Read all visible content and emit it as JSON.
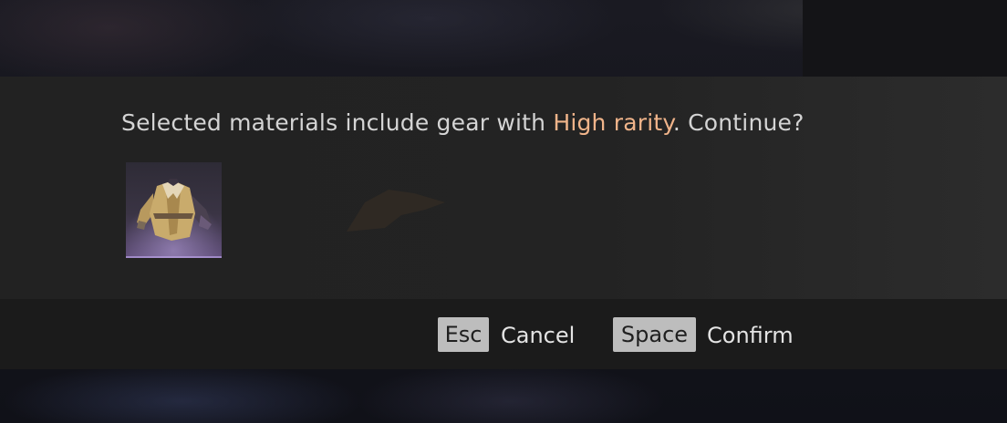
{
  "dialog": {
    "message_before": "Selected materials include gear with ",
    "message_highlight": "High rarity",
    "message_after": ". Continue?",
    "highlight_color": "#f0b48a",
    "items": [
      {
        "icon": "robe-armor-icon",
        "rarity_color": "#9d86c4"
      }
    ]
  },
  "actions": {
    "cancel": {
      "key": "Esc",
      "label": "Cancel"
    },
    "confirm": {
      "key": "Space",
      "label": "Confirm"
    }
  }
}
